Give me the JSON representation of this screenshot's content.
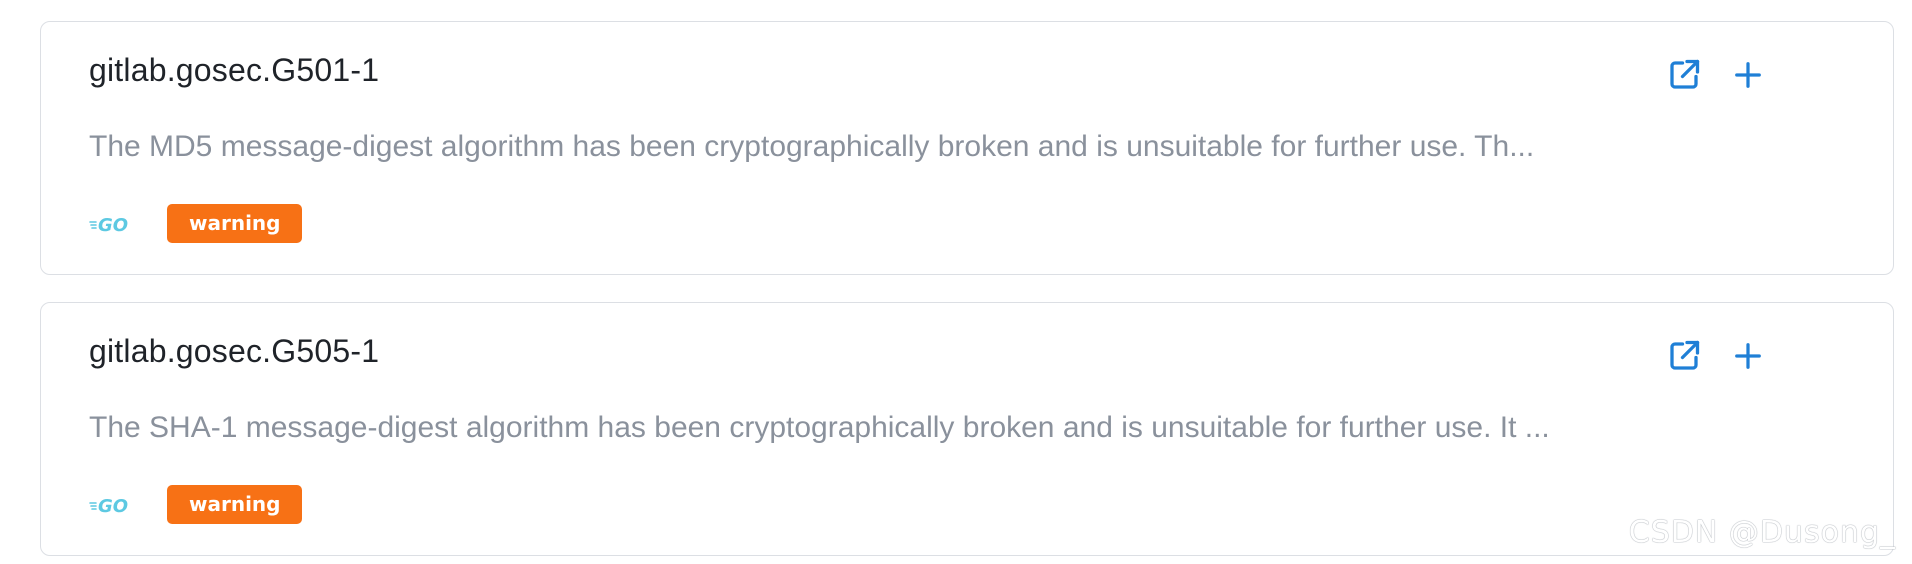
{
  "rules": [
    {
      "title": "gitlab.gosec.G501-1",
      "description": "The MD5 message-digest algorithm has been cryptographically broken and is unsuitable for further use. Th...",
      "language_icon": "go-icon",
      "severity": "warning"
    },
    {
      "title": "gitlab.gosec.G505-1",
      "description": "The SHA-1 message-digest algorithm has been cryptographically broken and is unsuitable for further use. It ...",
      "language_icon": "go-icon",
      "severity": "warning"
    }
  ],
  "icons": {
    "open": "external-link-icon",
    "add": "plus-icon"
  },
  "colors": {
    "accent": "#1f7fd6",
    "warning": "#f77115",
    "go": "#5dc9e2"
  },
  "watermark": "CSDN @Dusong_"
}
